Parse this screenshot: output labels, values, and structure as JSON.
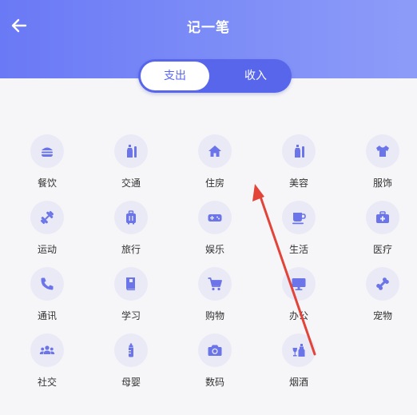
{
  "header": {
    "title": "记一笔",
    "back_icon": "arrow-left-icon"
  },
  "toggle": {
    "expense_label": "支出",
    "income_label": "收入",
    "active": "expense"
  },
  "colors": {
    "accent": "#5866ec",
    "icon_bg": "#e9eaf6",
    "icon_fg": "#6b74e8",
    "annotation_arrow": "#e2443a"
  },
  "categories": [
    {
      "label": "餐饮",
      "icon": "burger-icon"
    },
    {
      "label": "交通",
      "icon": "bottle-icon"
    },
    {
      "label": "住房",
      "icon": "home-icon"
    },
    {
      "label": "美容",
      "icon": "bottle-icon"
    },
    {
      "label": "服饰",
      "icon": "tshirt-icon"
    },
    {
      "label": "运动",
      "icon": "dumbbell-icon"
    },
    {
      "label": "旅行",
      "icon": "suitcase-icon"
    },
    {
      "label": "娱乐",
      "icon": "gamepad-icon"
    },
    {
      "label": "生活",
      "icon": "mug-icon"
    },
    {
      "label": "医疗",
      "icon": "medical-kit-icon"
    },
    {
      "label": "通讯",
      "icon": "phone-icon"
    },
    {
      "label": "学习",
      "icon": "book-icon"
    },
    {
      "label": "购物",
      "icon": "cart-icon"
    },
    {
      "label": "办公",
      "icon": "monitor-icon"
    },
    {
      "label": "宠物",
      "icon": "bone-icon"
    },
    {
      "label": "社交",
      "icon": "people-icon"
    },
    {
      "label": "母婴",
      "icon": "baby-bottle-icon"
    },
    {
      "label": "数码",
      "icon": "camera-icon"
    },
    {
      "label": "烟酒",
      "icon": "wine-icon"
    }
  ]
}
